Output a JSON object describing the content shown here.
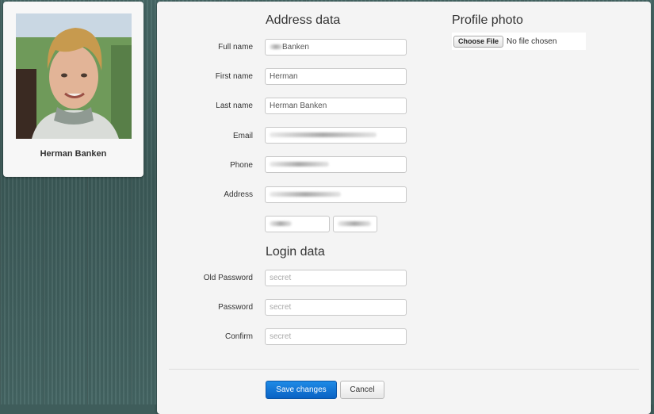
{
  "profile": {
    "name": "Herman Banken"
  },
  "address_section": {
    "heading": "Address data",
    "fields": {
      "full_name": {
        "label": "Full name",
        "value": "Banken"
      },
      "first_name": {
        "label": "First name",
        "value": "Herman"
      },
      "last_name": {
        "label": "Last name",
        "value": "Herman Banken"
      },
      "email": {
        "label": "Email",
        "value": ""
      },
      "phone": {
        "label": "Phone",
        "value": ""
      },
      "address": {
        "label": "Address",
        "value": ""
      }
    }
  },
  "photo_section": {
    "heading": "Profile photo",
    "choose_file_label": "Choose File",
    "file_status": "No file chosen"
  },
  "login_section": {
    "heading": "Login data",
    "fields": {
      "old_password": {
        "label": "Old Password",
        "placeholder": "secret"
      },
      "password": {
        "label": "Password",
        "placeholder": "secret"
      },
      "confirm": {
        "label": "Confirm",
        "placeholder": "secret"
      }
    }
  },
  "actions": {
    "save_label": "Save changes",
    "cancel_label": "Cancel"
  },
  "colors": {
    "primary_button": "#0a62c4",
    "background_wood": "#3f5d5b"
  },
  "icons": {
    "avatar": "person-photo"
  }
}
